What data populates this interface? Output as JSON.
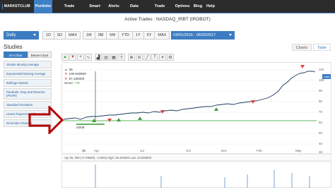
{
  "nav": {
    "logo_text": "MARKETCLUB",
    "items": [
      "Portfolio",
      "Trade Triangles",
      "Smart Scan",
      "Alerts",
      "Data Central",
      "Trade School",
      "Options",
      "Blog",
      "Help"
    ],
    "active": "Portfolio"
  },
  "title": "Active Trades : NASDAQ_IRBT (IROBOT)",
  "toolbar": {
    "interval": "Daily",
    "ranges": [
      "1D",
      "5D",
      "MAX",
      "1M",
      "3M",
      "6M",
      "YTD",
      "1Y",
      "5Y",
      "MAX"
    ],
    "date_range": "03/01/2016 - 06/20/2017"
  },
  "studies": {
    "label": "Studies",
    "tabs": [
      "On-Chart",
      "Below-Chart"
    ],
    "items": [
      "Simple Moving Average",
      "Exponential Moving Average",
      "Bollinger Bands",
      "Parabolic Stop and Reverse (PSAR)",
      "Standard Deviation",
      "Linear Regression Channel",
      "Donchian Channel"
    ]
  },
  "view_tabs": [
    "Charts",
    "Table"
  ],
  "legend": {
    "green_value": "36",
    "red_value_1": "100.949900",
    "red_value_2": "87.180000",
    "score_label": "Score",
    "score_value": "+75"
  },
  "price_tag": "Last",
  "x_labels": [
    "Apr",
    "Jul",
    "Oct",
    "Dec",
    "Feb",
    "May"
  ],
  "y_labels": [
    "110",
    "100",
    "90",
    "80",
    "70",
    "60",
    "50",
    "40",
    "30"
  ],
  "annotation_date": "04/08",
  "annotation_value": "36",
  "info_line": "Apr 25,     000 (-0.705000, -1.89%) High: 35.440000 Low: 34.500000",
  "colors": {
    "nav_bg": "#2c2c2c",
    "accent": "#3c7dc2",
    "arrow": "#b40000",
    "price_line": "#1e3a5f",
    "support": "#2e9b2e"
  }
}
